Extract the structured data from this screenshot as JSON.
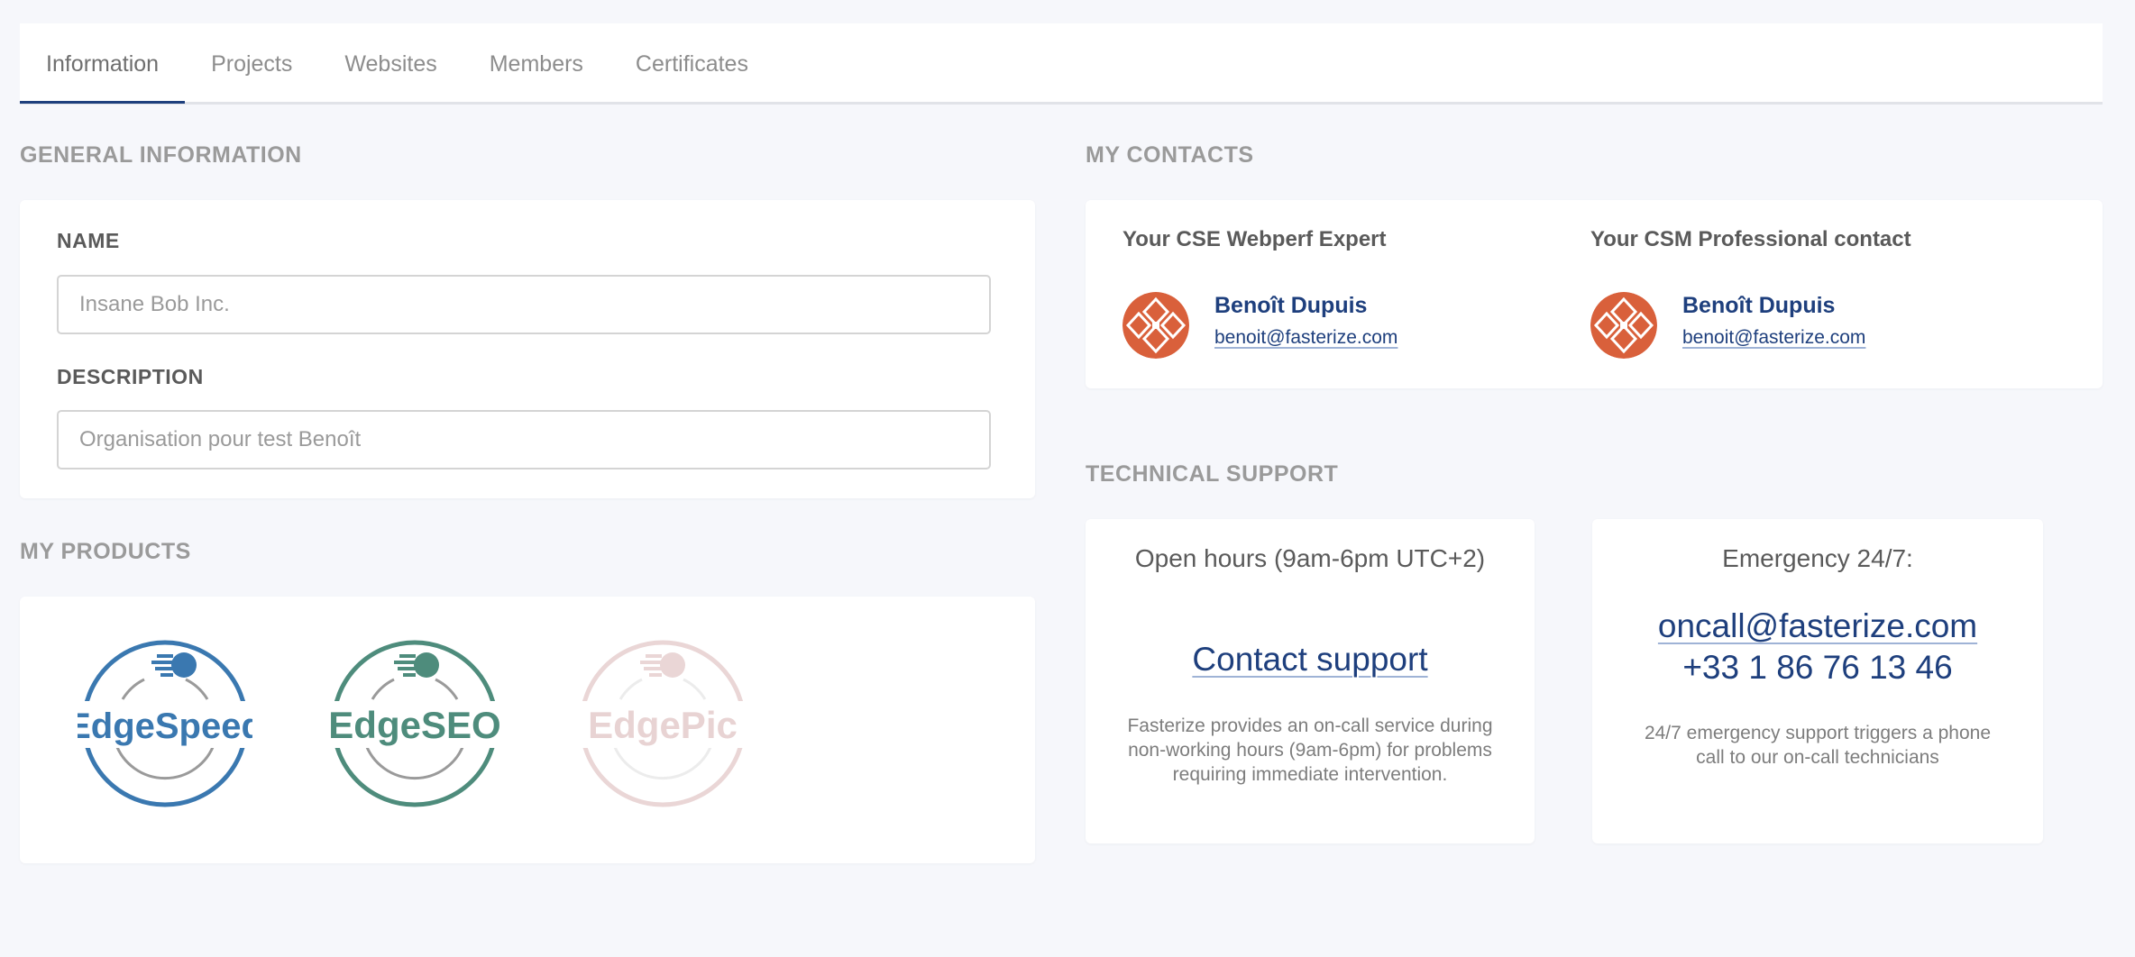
{
  "tabs": [
    {
      "label": "Information",
      "active": true
    },
    {
      "label": "Projects"
    },
    {
      "label": "Websites"
    },
    {
      "label": "Members"
    },
    {
      "label": "Certificates"
    }
  ],
  "general": {
    "title": "GENERAL INFORMATION",
    "name_label": "NAME",
    "name_placeholder": "Insane Bob Inc.",
    "description_label": "DESCRIPTION",
    "description_placeholder": "Organisation pour test Benoît"
  },
  "products": {
    "title": "MY PRODUCTS",
    "items": [
      {
        "label": "EdgeSpeed",
        "color": "#3a78b0",
        "enabled": true
      },
      {
        "label": "EdgeSEO",
        "color": "#4e8c7c",
        "enabled": true
      },
      {
        "label": "EdgePic",
        "color": "#e8d3d3",
        "enabled": false
      }
    ]
  },
  "contacts": {
    "title": "MY CONTACTS",
    "items": [
      {
        "role": "Your CSE Webperf Expert",
        "name": "Benoît Dupuis",
        "email": "benoit@fasterize.com"
      },
      {
        "role": "Your CSM Professional contact",
        "name": "Benoît Dupuis",
        "email": "benoit@fasterize.com"
      }
    ]
  },
  "support": {
    "title": "TECHNICAL SUPPORT",
    "open_hours": {
      "title": "Open hours (9am-6pm UTC+2)",
      "link": "Contact support",
      "description": "Fasterize provides an on-call service during non-working hours (9am-6pm) for problems requiring immediate intervention."
    },
    "emergency": {
      "title": "Emergency 24/7:",
      "email": "oncall@fasterize.com",
      "phone": "+33 1 86 76 13 46",
      "description": "24/7 emergency support triggers a phone call to our on-call technicians"
    }
  },
  "colors": {
    "accent": "#1e3f7d",
    "avatar": "#d9603b",
    "background": "#f6f7fb"
  }
}
